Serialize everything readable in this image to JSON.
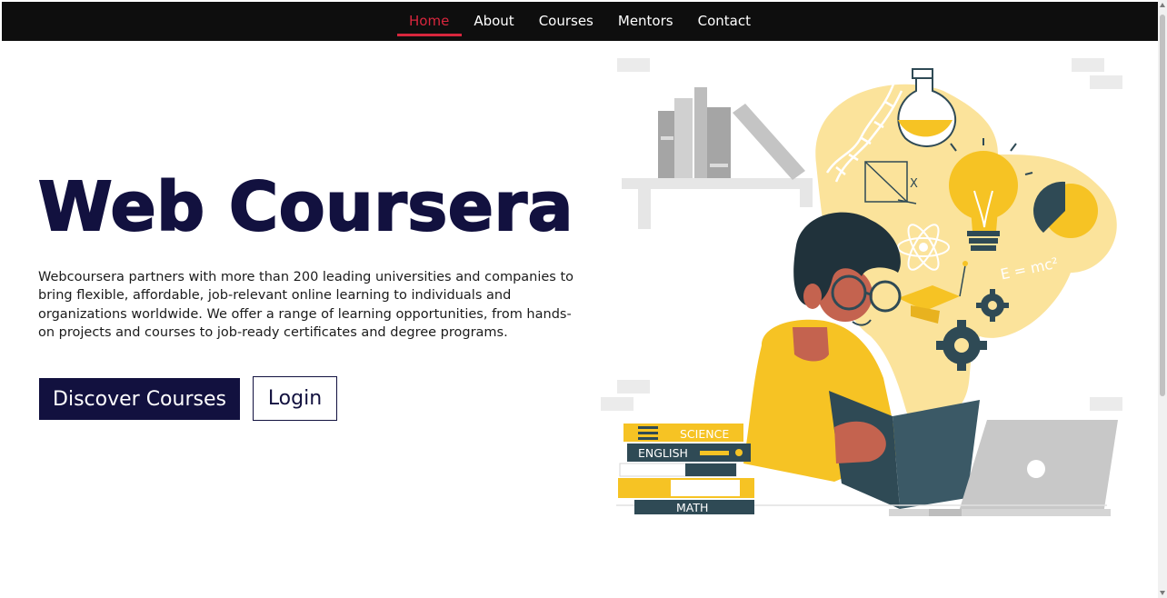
{
  "nav": {
    "items": [
      {
        "label": "Home",
        "active": true
      },
      {
        "label": "About",
        "active": false
      },
      {
        "label": "Courses",
        "active": false
      },
      {
        "label": "Mentors",
        "active": false
      },
      {
        "label": "Contact",
        "active": false
      }
    ]
  },
  "hero": {
    "title": "Web Coursera",
    "description": "Webcoursera partners with more than 200 leading universities and companies to bring flexible, affordable, job-relevant online learning to individuals and organizations worldwide. We offer a range of learning opportunities, from hands-on projects and courses to job-ready certificates and degree programs.",
    "primary_button": "Discover Courses",
    "secondary_button": "Login"
  },
  "illustration": {
    "book_labels": {
      "science": "SCIENCE",
      "english": "ENGLISH",
      "math": "MATH"
    },
    "formula": "E = mc²",
    "axis_letter": "X"
  },
  "colors": {
    "nav_bg": "#0e0e0e",
    "accent": "#d7263d",
    "brand": "#12113f",
    "yellow": "#f6c324",
    "dark_teal": "#2f4a55"
  }
}
